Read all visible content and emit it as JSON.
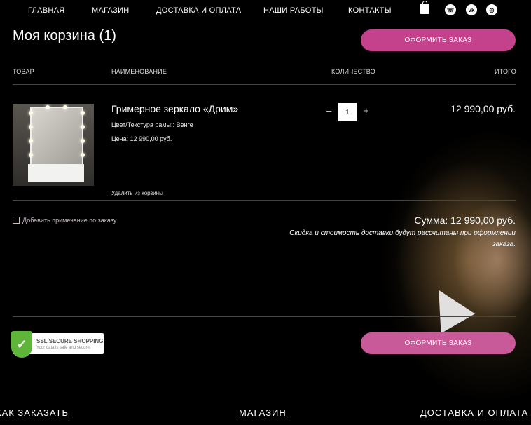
{
  "nav": {
    "items": [
      "Главная",
      "Магазин",
      "Доставка и оплата",
      "Наши работы",
      "Контакты"
    ],
    "social": [
      "whatsapp-icon",
      "vk-icon",
      "instagram-icon"
    ]
  },
  "cart": {
    "title": "Моя корзина (1)",
    "checkout_label": "Оформить заказ",
    "columns": [
      "Товар",
      "Наименование",
      "Количество",
      "Итого"
    ],
    "item": {
      "name": "Гримерное зеркало «Дрим»",
      "attribute": "Цвет/Текстура рамы:: Венге",
      "price": "Цена: 12 990,00 руб.",
      "remove_label": "Удалить из корзины",
      "quantity": "1",
      "minus": "–",
      "plus": "+",
      "total": "12 990,00 руб."
    },
    "note_label": "Добавить примечание по заказу",
    "sum": "Сумма: 12 990,00 руб.",
    "disclaimer": "Скидка и стоимость доставки будут рассчитаны при оформлении заказа."
  },
  "ssl": {
    "title": "SSL SECURE SHOPPING",
    "subtitle": "Your data is safe and secure."
  },
  "footer": {
    "links": [
      "КАК ЗАКАЗАТЬ",
      "МАГАЗИН",
      "ДОСТАВКА И ОПЛАТА"
    ]
  },
  "colors": {
    "accent": "#c4418c",
    "background": "#000000"
  }
}
